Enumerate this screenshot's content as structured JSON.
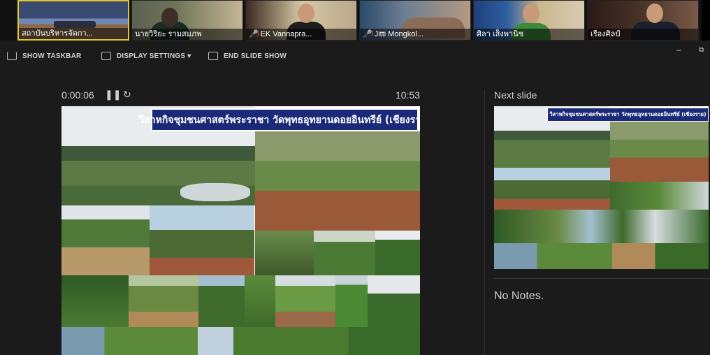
{
  "participants": [
    {
      "name": "สถาบันบริหารจัดกา...",
      "muted": false,
      "active": true
    },
    {
      "name": "นายวิริยะ รามสมภพ",
      "muted": false,
      "active": false
    },
    {
      "name": "EK Vannapra...",
      "muted": true,
      "active": false
    },
    {
      "name": "Jitti Mongkol...",
      "muted": true,
      "active": false
    },
    {
      "name": "ศิลา เส็งพานิช",
      "muted": false,
      "active": false
    },
    {
      "name": "เรืองศิลป์",
      "muted": false,
      "active": false
    }
  ],
  "toolbar": {
    "show_taskbar": "SHOW TASKBAR",
    "display_settings": "DISPLAY SETTINGS ▾",
    "end_slide_show": "END SLIDE SHOW",
    "minimize": "–",
    "restore": "⧉"
  },
  "presenter": {
    "elapsed": "0:00:06",
    "pause_icon": "pause-icon",
    "restart_icon": "restart-icon",
    "clock": "10:53",
    "current_slide_title": "วิสาหกิจชุมชนศาสตร์พระราชา วัดพุทธอุทยานดอยอินทรีย์ (เชียงราย)",
    "next_slide_label": "Next slide",
    "next_slide_title": "วิสาหกิจชุมชนศาสตร์พระราชา วัดพุทธอุทยานดอยอินทรีย์ (เชียงราย)",
    "notes": "No Notes."
  },
  "colors": {
    "background": "#1b1b1b",
    "active_speaker": "#e2c530",
    "title_banner": "#1b2a78",
    "muted_mic": "#e04040"
  }
}
